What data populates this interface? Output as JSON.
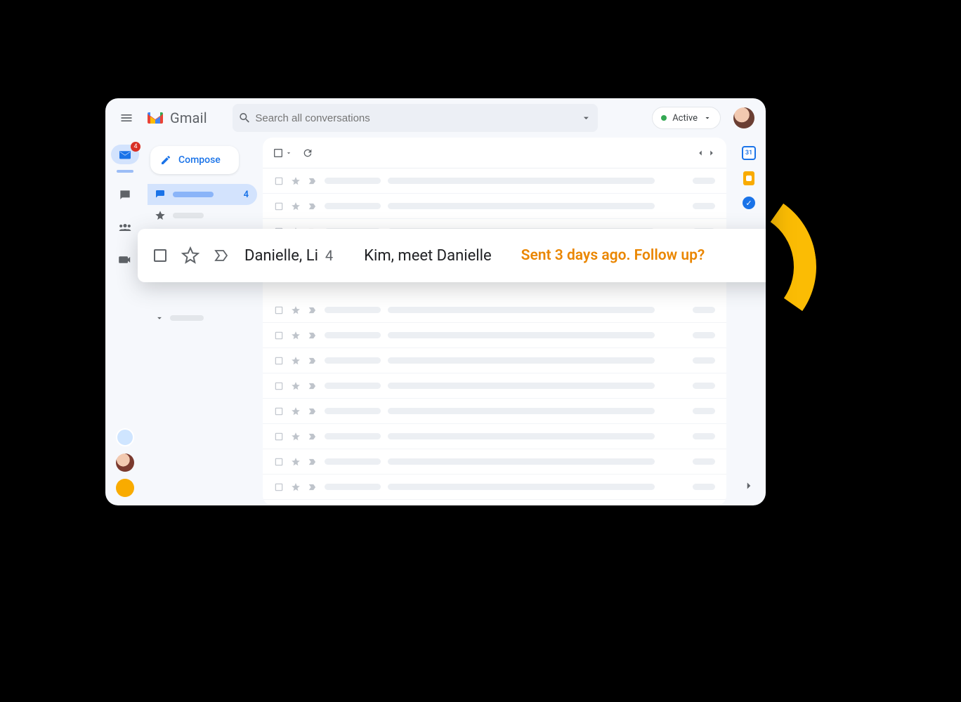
{
  "brand": "Gmail",
  "search": {
    "placeholder": "Search all conversations"
  },
  "status": {
    "label": "Active"
  },
  "rail": {
    "mail_badge": "4"
  },
  "compose_label": "Compose",
  "sidebar": {
    "inbox_count": "4"
  },
  "side_panel": {
    "calendar_day": "31"
  },
  "highlight": {
    "senders": "Danielle, Li",
    "count": "4",
    "subject": "Kim, meet Danielle",
    "prompt": "Sent 3 days ago. Follow up?"
  }
}
